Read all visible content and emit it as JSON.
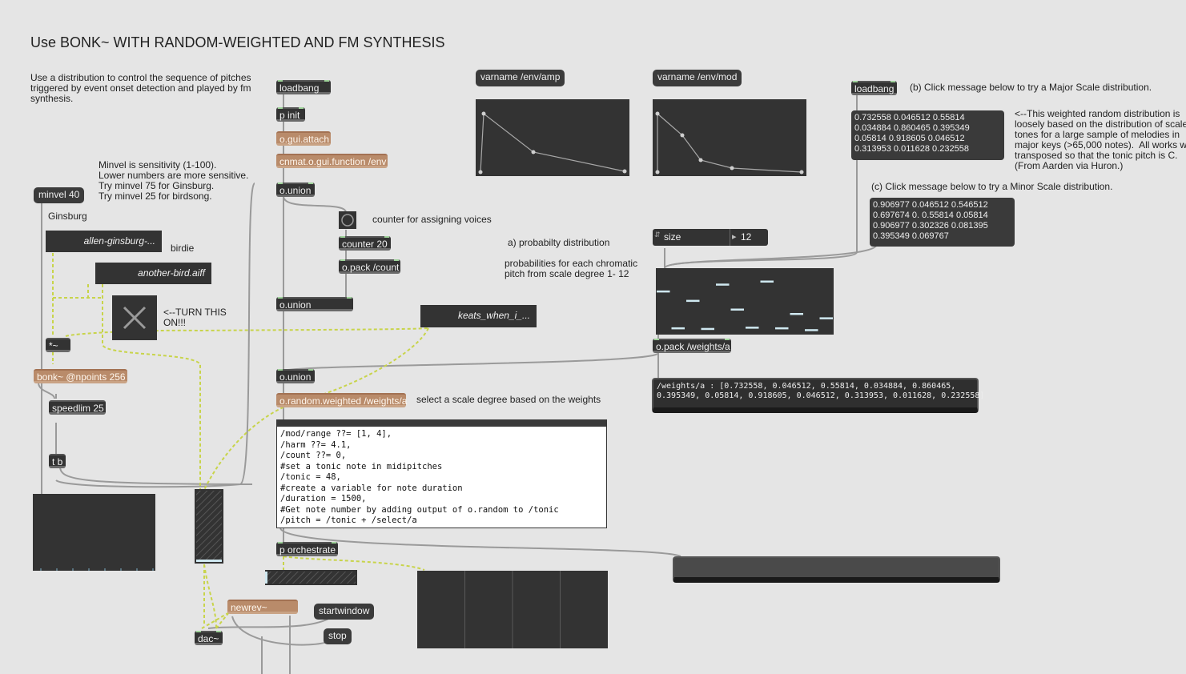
{
  "title": "Use BONK~ WITH RANDOM-WEIGHTED AND FM SYNTHESIS",
  "intro": "Use a distribution to control the sequence of pitches\ntriggered by event onset detection and played by fm\nsynthesis.",
  "minvel_note": "Minvel is sensitivity (1-100).\nLower numbers are more sensitive.\nTry minvel 75 for Ginsburg.\nTry minvel 25 for birdsong.",
  "labels": {
    "ginsburg": "Ginsburg",
    "birdie": "birdie",
    "turn_on": "<--TURN THIS\nON!!!",
    "counter_note": "counter for assigning voices",
    "prob_a": "a) probabilty distribution",
    "prob_desc": "probabilities for each chromatic\npitch from scale degree 1- 12",
    "select_note": "select a scale degree based on the weights",
    "major_note": "(b) Click message below to try a Major Scale distribution.",
    "major_desc": "<--This weighted random distribution is\nloosely based on the distribution of scale\ntones for a large sample of melodies in\nmajor keys (>65,000 notes).  All works were\ntransposed so that the tonic pitch is C.\n(From Aarden via Huron.)",
    "minor_note": "(c) Click message below to try a Minor Scale distribution."
  },
  "objects": {
    "loadbang1": "loadbang",
    "p_init": "p init",
    "gui_attach": "o.gui.attach",
    "gui_function": "cnmat.o.gui.function /env",
    "union1": "o.union",
    "counter": "counter 20",
    "pack_count": "o.pack /count",
    "union2": "o.union",
    "union3": "o.union",
    "random_weighted": "o.random.weighted /weights/a",
    "orchestrate": "p orchestrate",
    "newrev": "newrev~",
    "dac": "dac~",
    "bonk": "bonk~ @npoints 256",
    "speedlim": "speedlim 25",
    "tb": "t b",
    "mul": "*~",
    "loadbang2": "loadbang",
    "pack_weights": "o.pack /weights/a",
    "varname_amp": "varname /env/amp",
    "varname_mod": "varname /env/mod"
  },
  "messages": {
    "minvel": "minvel 40",
    "startwindow": "startwindow",
    "stop": "stop",
    "major_values": "0.732558 0.046512 0.55814\n0.034884 0.860465 0.395349\n0.05814 0.918605 0.046512\n0.313953 0.011628 0.232558",
    "minor_values": "0.906977 0.046512 0.546512\n0.697674 0. 0.55814 0.05814\n0.906977 0.302326 0.081395\n0.395349 0.069767"
  },
  "soundfiles": {
    "ginsburg": "allen-ginsburg-...",
    "bird": "another-bird.aiff",
    "keats": "keats_when_i_..."
  },
  "size_box": {
    "label": "size",
    "value": "12"
  },
  "code": "/mod/range ??= [1, 4],\n/harm ??= 4.1,\n/count ??= 0,\n#set a tonic note in midipitches\n/tonic = 48,\n#create a variable for note duration\n/duration = 1500,\n#Get note number by adding output of o.random to /tonic\n/pitch = /tonic + /select/a",
  "weights_display": "/weights/a : [0.732558, 0.046512, 0.55814, 0.034884, 0.860465,\n0.395349, 0.05814, 0.918605, 0.046512, 0.313953, 0.011628, 0.232558]",
  "multislider_values": [
    0.732558,
    0.046512,
    0.55814,
    0.034884,
    0.860465,
    0.395349,
    0.05814,
    0.918605,
    0.046512,
    0.313953,
    0.011628,
    0.232558
  ],
  "colors": {
    "background": "#e5e5e5",
    "object": "#333333",
    "tan_object": "#b98b6a",
    "patch_cord_signal": "#c8d44a",
    "patch_cord": "#9a9a9a",
    "slider_bar": "#cfe8f0"
  },
  "icons": {
    "toggle": "x-toggle-icon",
    "bang": "bang-icon"
  }
}
